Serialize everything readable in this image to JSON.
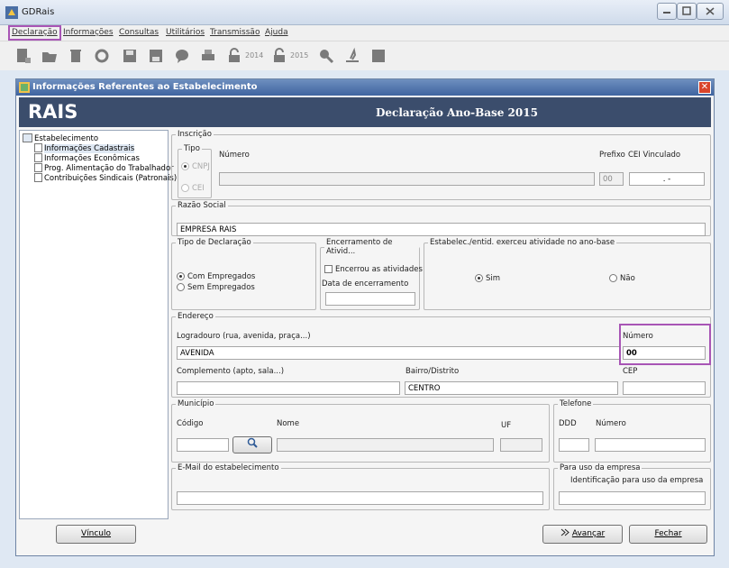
{
  "window": {
    "title": "GDRais"
  },
  "menu": [
    "Declaração",
    "Informações",
    "Consultas",
    "Utilitários",
    "Transmissão",
    "Ajuda"
  ],
  "toolbar": {
    "year1": "2014",
    "year2": "2015"
  },
  "dialog": {
    "title": "Informações Referentes ao Estabelecimento",
    "logo": "RAIS",
    "heading": "Declaração Ano-Base 2015",
    "close": "✕"
  },
  "tree": {
    "root": "Estabelecimento",
    "items": [
      "Informações Cadastrais",
      "Informações Econômicas",
      "Prog. Alimentação do Trabalhador",
      "Contribuições Sindicais (Patronais)"
    ]
  },
  "inscricao": {
    "legend": "Inscrição",
    "tipo_legend": "Tipo",
    "cnpj": "CNPJ",
    "cei": "CEI",
    "numero_label": "Número",
    "prefixo_label": "Prefixo",
    "prefixo_value": "00",
    "cei_vinc_label": "CEI Vinculado",
    "cei_vinc_value": ". -"
  },
  "razao": {
    "legend": "Razão Social",
    "value": "EMPRESA RAIS"
  },
  "tipo_decl": {
    "legend": "Tipo de Declaração",
    "opt1": "Com Empregados",
    "opt2": "Sem Empregados"
  },
  "encerramento": {
    "legend": "Encerramento de Ativid...",
    "check": "Encerrou as atividades",
    "data_label": "Data de encerramento"
  },
  "atividade": {
    "legend": "Estabelec./entid. exerceu atividade no ano-base",
    "sim": "Sim",
    "nao": "Não"
  },
  "endereco": {
    "legend": "Endereço",
    "logradouro_label": "Logradouro (rua, avenida, praça...)",
    "logradouro_value": "AVENIDA",
    "numero_label": "Número",
    "numero_value": "00",
    "complemento_label": "Complemento (apto, sala...)",
    "bairro_label": "Bairro/Distrito",
    "bairro_value": "CENTRO",
    "cep_label": "CEP"
  },
  "municipio": {
    "legend": "Município",
    "codigo_label": "Código",
    "nome_label": "Nome",
    "uf_label": "UF"
  },
  "telefone": {
    "legend": "Telefone",
    "ddd_label": "DDD",
    "numero_label": "Número"
  },
  "email": {
    "legend": "E-Mail do estabelecimento"
  },
  "uso": {
    "legend": "Para uso da empresa",
    "label": "Identificação para uso da empresa"
  },
  "buttons": {
    "vinculo": "Vínculo",
    "avancar": "Avançar",
    "fechar": "Fechar"
  }
}
